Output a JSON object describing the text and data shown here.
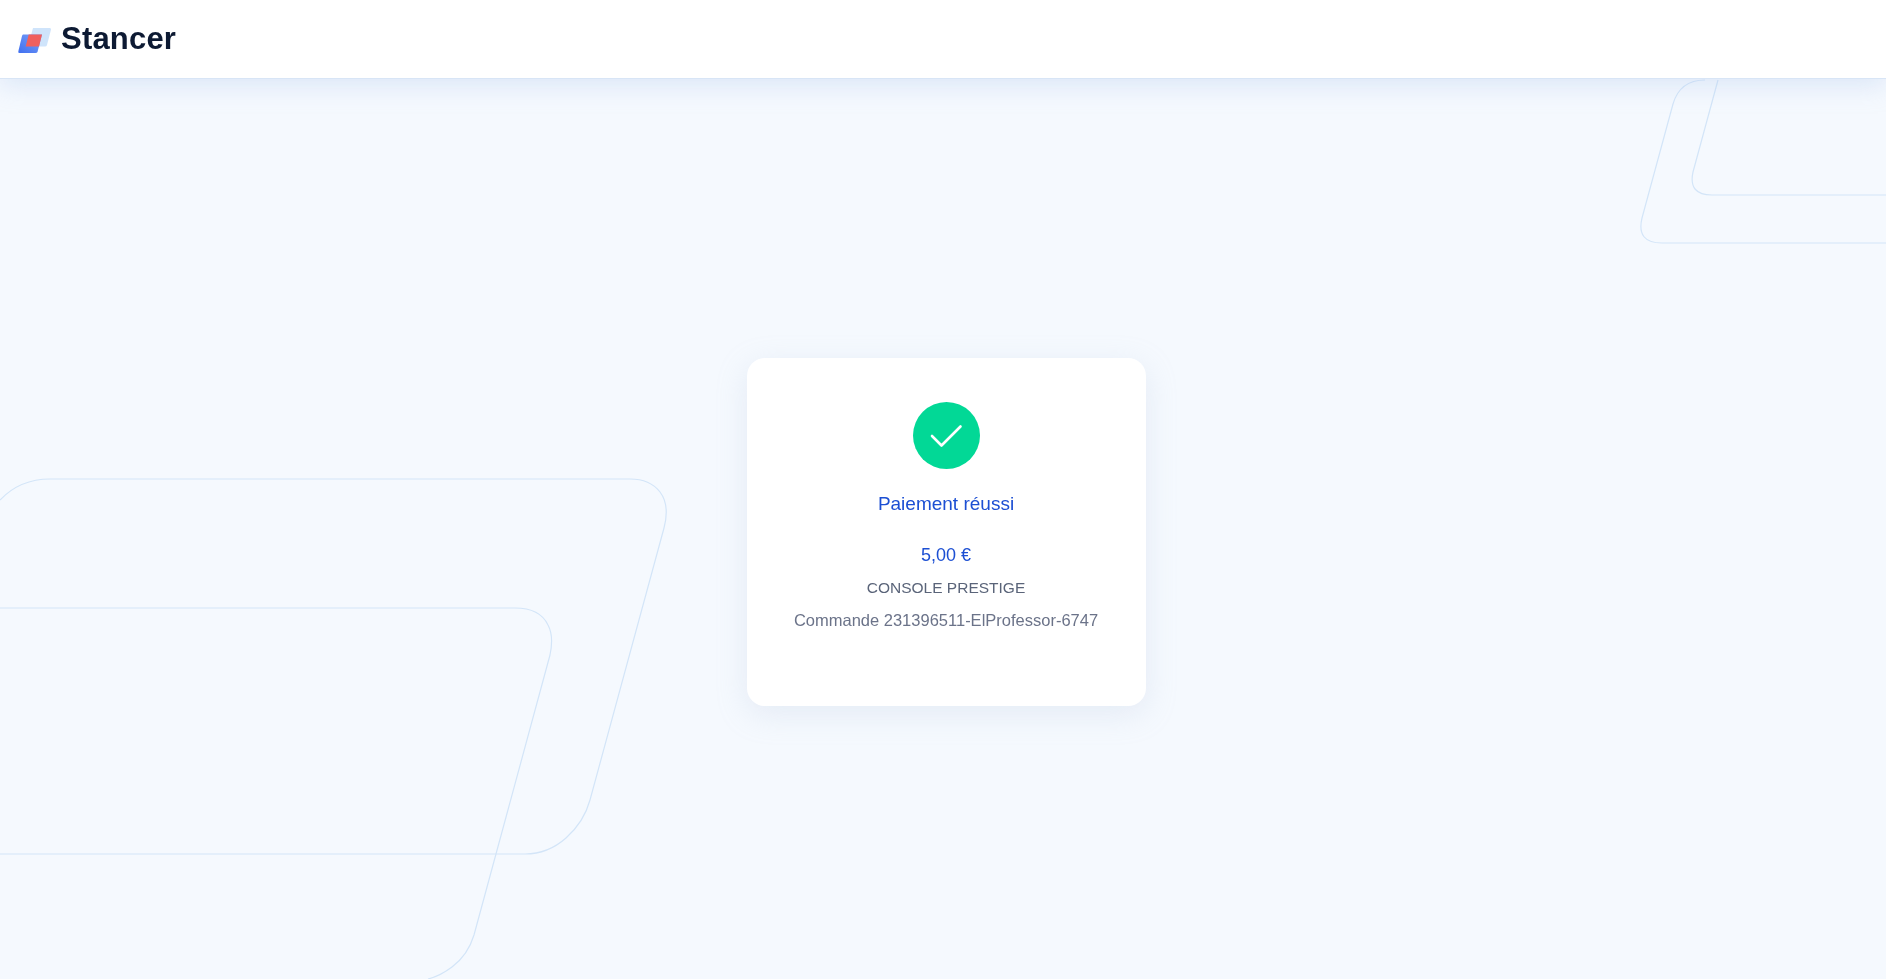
{
  "header": {
    "brand": "Stancer"
  },
  "payment": {
    "paid": true,
    "title": "Paiement réussi",
    "amount": "5,00 €",
    "product": "CONSOLE PRESTIGE",
    "order": "Commande 231396511-ElProfessor-6747"
  }
}
